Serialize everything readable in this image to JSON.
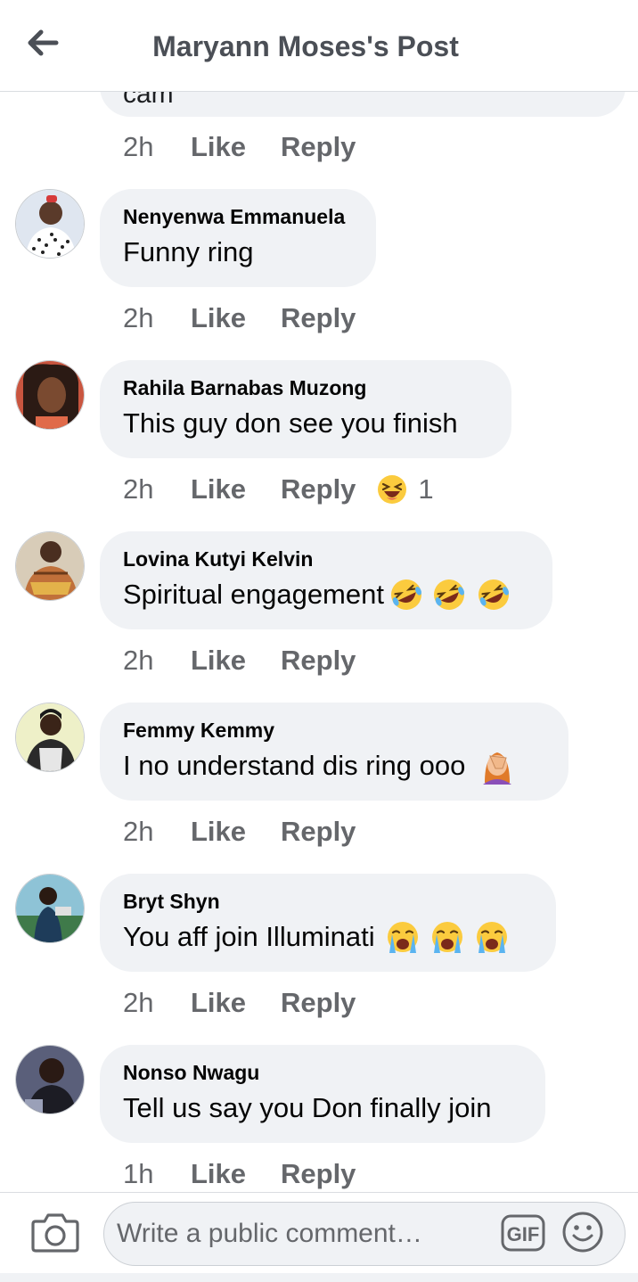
{
  "header": {
    "title": "Maryann Moses's Post",
    "back_icon": "arrow-left-icon"
  },
  "partial_comment": {
    "text_fragment": "cam",
    "time": "2h",
    "like": "Like",
    "reply": "Reply"
  },
  "comments": [
    {
      "name": "Nenyenwa Emmanuela",
      "text": "Funny ring",
      "emojis": [],
      "time": "2h",
      "like": "Like",
      "reply": "Reply",
      "avatar_color": "#4a5a7a"
    },
    {
      "name": "Rahila Barnabas Muzong",
      "text": "This guy don see you finish",
      "emojis": [],
      "time": "2h",
      "like": "Like",
      "reply": "Reply",
      "reaction_icon": "laughing-squint-emoji",
      "reaction_count": "1",
      "avatar_color": "#b04a3e"
    },
    {
      "name": "Lovina Kutyi Kelvin",
      "text": "Spiritual engagement",
      "emojis": [
        "rolling-on-floor-laughing-emoji",
        "rolling-on-floor-laughing-emoji",
        "rolling-on-floor-laughing-emoji"
      ],
      "time": "2h",
      "like": "Like",
      "reply": "Reply",
      "avatar_color": "#8a6b52"
    },
    {
      "name": "Femmy Kemmy",
      "text": "I no understand dis ring ooo",
      "emojis": [
        "woman-facepalming-emoji"
      ],
      "time": "2h",
      "like": "Like",
      "reply": "Reply",
      "avatar_color": "#c9c38a"
    },
    {
      "name": "Bryt Shyn",
      "text": "You aff join Illuminati",
      "emojis": [
        "loudly-crying-emoji",
        "loudly-crying-emoji",
        "loudly-crying-emoji"
      ],
      "time": "2h",
      "like": "Like",
      "reply": "Reply",
      "avatar_color": "#4f8fa3"
    },
    {
      "name": "Nonso Nwagu",
      "text": "Tell us say you Don finally join",
      "emojis": [],
      "time": "1h",
      "like": "Like",
      "reply": "Reply",
      "avatar_color": "#3c3f58"
    }
  ],
  "composer": {
    "placeholder": "Write a public comment…",
    "camera_icon": "camera-icon",
    "gif_label": "GIF",
    "emoji_icon": "smiley-icon"
  },
  "colors": {
    "bubble": "#f0f2f5",
    "meta_text": "#65676b",
    "header_text": "#4b4f56"
  }
}
